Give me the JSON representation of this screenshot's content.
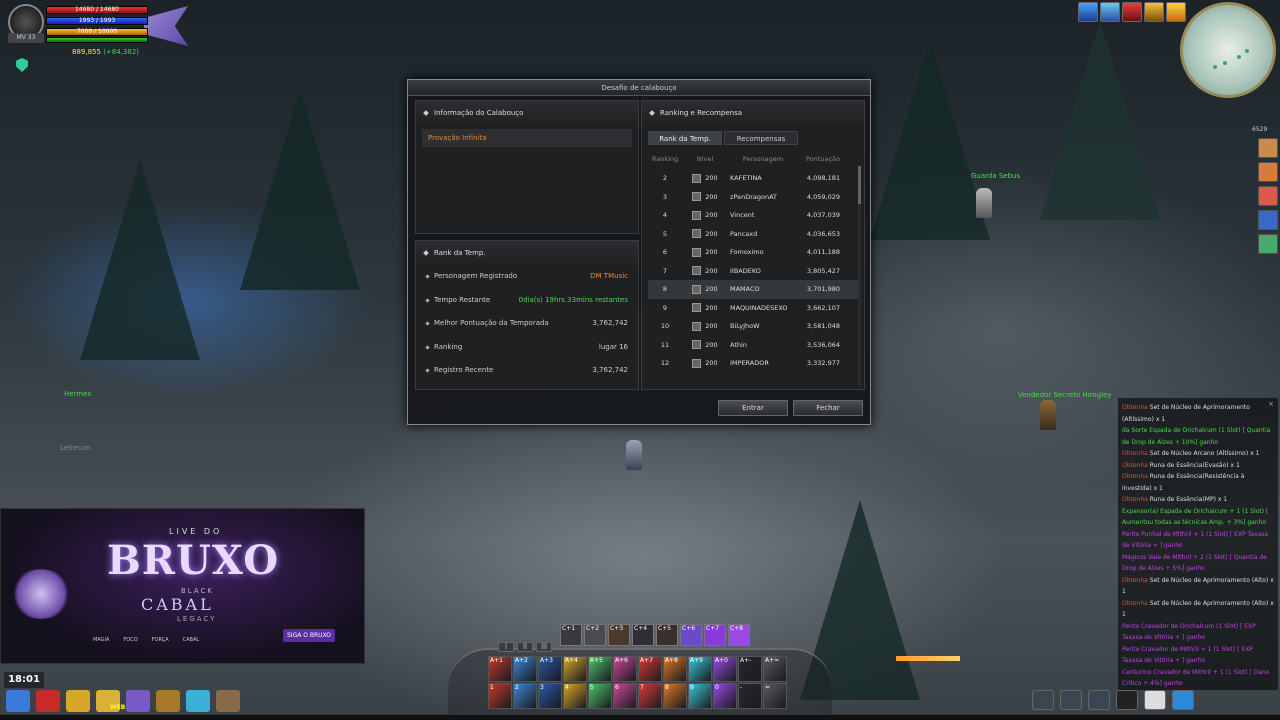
{
  "player": {
    "hp": "14680 / 14680",
    "mp": "1993 / 1993",
    "sp": "7000 / 10000",
    "level": "33",
    "level_prefix": "MV",
    "alz": "889,855",
    "alz_delta": "(+84,382)"
  },
  "npcs": [
    {
      "name": "Guarda Sebus"
    },
    {
      "name": "Vendedor Secreto Hirogley"
    },
    {
      "name": "Hermes"
    },
    {
      "name": "Letrecon"
    }
  ],
  "dialog": {
    "title": "Desafio de calabouço",
    "info_panel": {
      "header": "Informação do Calabouço",
      "selected": "Provação Infinita"
    },
    "season_panel": {
      "header": "Rank da Temp.",
      "rows": [
        {
          "label": "Personagem Registrado",
          "value": "DM TMusic"
        },
        {
          "label": "Tempo Restante",
          "value": "0dia(s) 19hrs 33mins restantes"
        },
        {
          "label": "Melhor Pontuação da Temporada",
          "value": "3,762,742"
        },
        {
          "label": "Ranking",
          "value": "lugar 16"
        },
        {
          "label": "Registro Recente",
          "value": "3,762,742"
        }
      ]
    },
    "ranking_panel": {
      "header": "Ranking e Recompensa",
      "tabs": [
        "Rank da Temp.",
        "Recompensas"
      ],
      "columns": [
        "Ranking",
        "Nível",
        "Personagem",
        "Pontuação"
      ],
      "rows": [
        {
          "rank": "2",
          "level": "200",
          "name": "KAFETINA",
          "points": "4,098,181"
        },
        {
          "rank": "3",
          "level": "200",
          "name": "zPenDragonAT",
          "points": "4,059,029"
        },
        {
          "rank": "4",
          "level": "200",
          "name": "Vincent",
          "points": "4,037,039"
        },
        {
          "rank": "5",
          "level": "200",
          "name": "Pancaxd",
          "points": "4,036,653"
        },
        {
          "rank": "6",
          "level": "200",
          "name": "Fomoximo",
          "points": "4,011,188"
        },
        {
          "rank": "7",
          "level": "200",
          "name": "IIBADEKO",
          "points": "3,805,427"
        },
        {
          "rank": "8",
          "level": "200",
          "name": "MAMACO",
          "points": "3,701,980"
        },
        {
          "rank": "9",
          "level": "200",
          "name": "MAQUINADESEXO",
          "points": "3,662,107"
        },
        {
          "rank": "10",
          "level": "200",
          "name": "BiLyJhoW",
          "points": "3,581,048"
        },
        {
          "rank": "11",
          "level": "200",
          "name": "Athin",
          "points": "3,536,064"
        },
        {
          "rank": "12",
          "level": "200",
          "name": "IMPERADOR",
          "points": "3,332,977"
        }
      ]
    },
    "enter_label": "Entrar",
    "close_label": "Fechar"
  },
  "overlay": {
    "live": "LIVE DO",
    "title": "BRUXO",
    "black": "BLACK",
    "cabal": "CABAL",
    "legacy": "LEGACY",
    "tags": [
      "MAGIA",
      "FOCO",
      "FORÇA",
      "CABAL"
    ],
    "twitch": "SIGA O BRUXO"
  },
  "chat": [
    {
      "color": "red",
      "text": "Obtenha",
      "rest": " Set de Núcleo de Aprimoramento (Altíssimo) x 1"
    },
    {
      "color": "green",
      "text": "da Sorte Espada de Orichalcum (1 Slot) [ Quantia de Drop de Alzes + 10%] ganho",
      "rest": ""
    },
    {
      "color": "red",
      "text": "Obtenha",
      "rest": " Set de Núcleo Arcano (Altíssimo) x 1"
    },
    {
      "color": "red",
      "text": "Obtenha",
      "rest": " Runa de Essência(Evasão) x 1"
    },
    {
      "color": "red",
      "text": "Obtenha",
      "rest": " Runa de Essência(Resistência à investida) x 1"
    },
    {
      "color": "red",
      "text": "Obtenha",
      "rest": " Runa de Essência(MP) x 1"
    },
    {
      "color": "green",
      "text": "Expansor(a) Espada de Orichalcum + 1 (1 Slot) [ Aumentou todas as técnicas Amp. + 3%] ganho",
      "rest": ""
    },
    {
      "color": "purple",
      "text": "Perito Punhal de Mithril + 1 (1 Slot) [ EXP Taxasa de Vitória + ] ganho",
      "rest": ""
    },
    {
      "color": "purple",
      "text": "Mágicos Vale de Mithril + 2 (1 Slot) [ Quantia de Drop de Alzes + 5%] ganho",
      "rest": ""
    },
    {
      "color": "red",
      "text": "Obtenha",
      "rest": " Set de Núcleo de Aprimoramento (Alto) x 1"
    },
    {
      "color": "red",
      "text": "Obtenha",
      "rest": " Set de Núcleo de Aprimoramento (Alto) x 1"
    },
    {
      "color": "purple",
      "text": "Perito Cravador de Orichalcum (1 Slot) [ EXP Taxasa de Vitória + ] ganho",
      "rest": ""
    },
    {
      "color": "purple",
      "text": "Perito Cravador de Mithril + 1 (1 Slot) [ EXP Taxasa de Vitória + ] ganho",
      "rest": ""
    },
    {
      "color": "purple",
      "text": "Centurino Cravador de Mithril + 1 (1 Slot) [ Dano Crítico + 4%] ganho",
      "rest": ""
    }
  ],
  "clock": "18:01",
  "quickbar": [
    "C+1",
    "C+2",
    "C+3",
    "C+4",
    "C+5",
    "C+6",
    "C+7",
    "C+8"
  ],
  "skills": [
    "A+1",
    "A+2",
    "A+3",
    "A+4",
    "A+5",
    "A+6",
    "A+7",
    "A+8",
    "A+9",
    "A+0",
    "A+-",
    "A+=",
    "1",
    "2",
    "3",
    "4",
    "5",
    "6",
    "7",
    "8",
    "9",
    "0",
    "-",
    "="
  ],
  "web_label": "WEB",
  "coord": "6529"
}
